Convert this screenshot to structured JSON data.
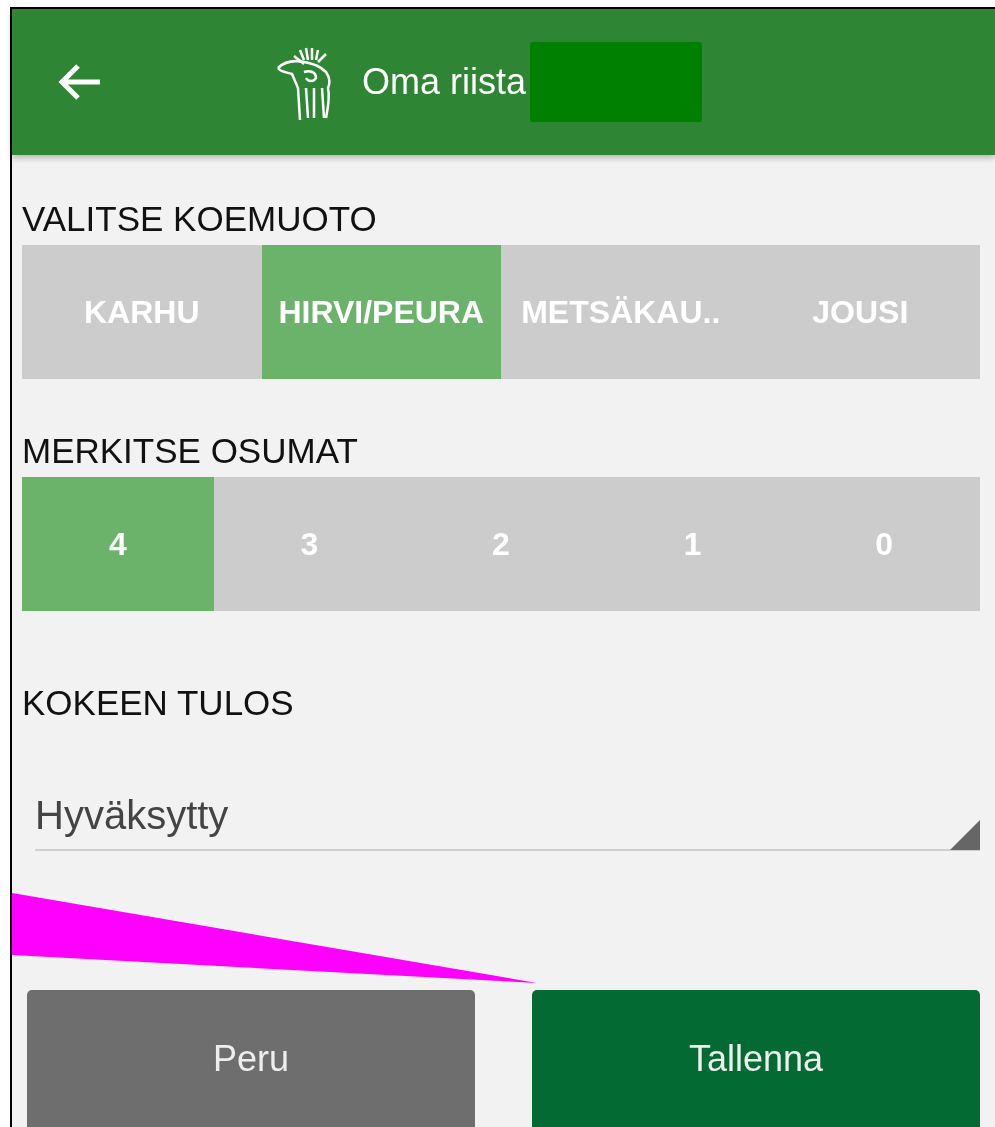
{
  "app_bar": {
    "title": "Oma riista"
  },
  "test_type": {
    "heading": "VALITSE KOEMUOTO",
    "options": [
      {
        "label": "KARHU",
        "selected": false
      },
      {
        "label": "HIRVI/PEURA",
        "selected": true
      },
      {
        "label": "METSÄKAU..",
        "selected": false
      },
      {
        "label": "JOUSI",
        "selected": false
      }
    ]
  },
  "hits": {
    "heading": "MERKITSE OSUMAT",
    "options": [
      {
        "label": "4",
        "selected": true
      },
      {
        "label": "3",
        "selected": false
      },
      {
        "label": "2",
        "selected": false
      },
      {
        "label": "1",
        "selected": false
      },
      {
        "label": "0",
        "selected": false
      }
    ]
  },
  "result": {
    "heading": "KOKEEN TULOS",
    "value": "Hyväksytty"
  },
  "buttons": [
    {
      "label": "Peru",
      "kind": "cancel"
    },
    {
      "label": "Tallenna",
      "kind": "save"
    }
  ]
}
